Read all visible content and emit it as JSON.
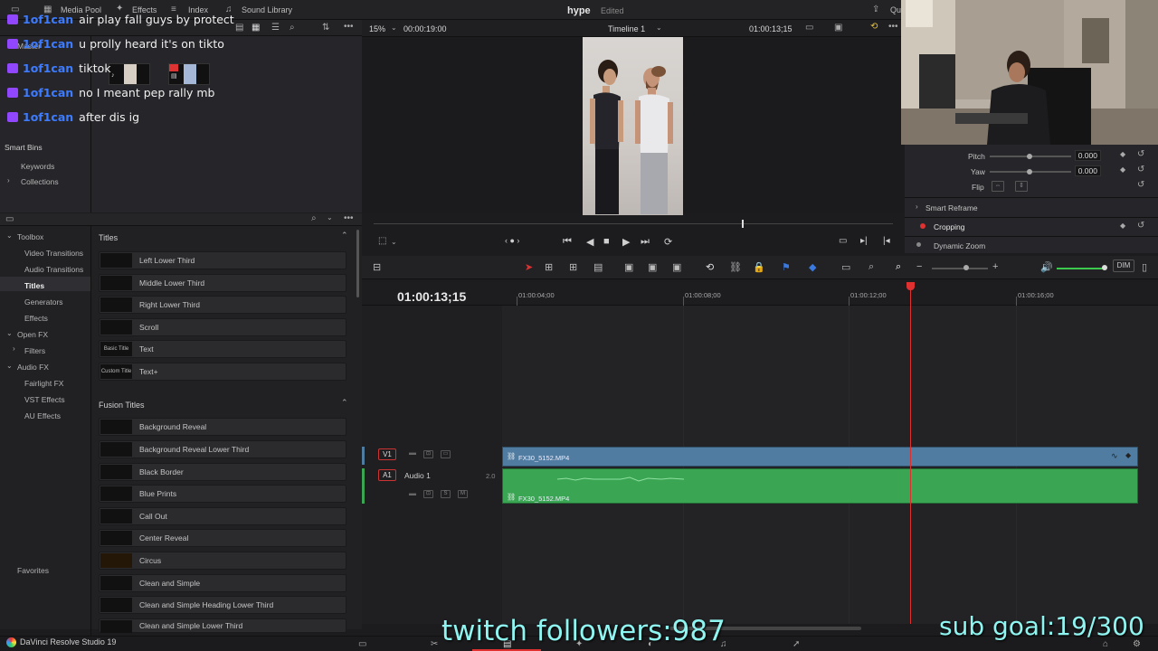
{
  "topbar": {
    "media_pool": "Media Pool",
    "effects": "Effects",
    "index": "Index",
    "sound_library": "Sound Library",
    "project_name": "hype",
    "project_status": "Edited",
    "quick_export": "Qu"
  },
  "viewer_bar": {
    "zoom": "15%",
    "source_tc": "00:00:19:00",
    "timeline_name": "Timeline 1",
    "record_tc": "01:00:13;15"
  },
  "media_pool": {
    "master": "Master",
    "smart_bins": "Smart Bins",
    "keywords": "Keywords",
    "collections": "Collections"
  },
  "inspector": {
    "pitch_label": "Pitch",
    "pitch_value": "0.000",
    "yaw_label": "Yaw",
    "yaw_value": "0.000",
    "flip_label": "Flip",
    "smart_reframe": "Smart Reframe",
    "cropping": "Cropping",
    "dynamic_zoom": "Dynamic Zoom"
  },
  "toolbox": {
    "categories": [
      "Toolbox",
      "Video Transitions",
      "Audio Transitions",
      "Titles",
      "Generators",
      "Effects",
      "Open FX",
      "Filters",
      "Audio FX",
      "Fairlight FX",
      "VST Effects",
      "AU Effects"
    ],
    "favorites": "Favorites",
    "titles_header": "Titles",
    "titles": [
      "Left Lower Third",
      "Middle Lower Third",
      "Right Lower Third",
      "Scroll",
      "Text",
      "Text+"
    ],
    "title_thumbs": [
      "",
      "",
      "",
      "",
      "Basic Title",
      "Custom Title"
    ],
    "fusion_header": "Fusion Titles",
    "fusion_titles": [
      "Background Reveal",
      "Background Reveal Lower Third",
      "Black Border",
      "Blue Prints",
      "Call Out",
      "Center Reveal",
      "Circus",
      "Clean and Simple",
      "Clean and Simple Heading Lower Third",
      "Clean and Simple Lower Third"
    ]
  },
  "timeline": {
    "timecode": "01:00:13;15",
    "ruler": [
      "01:00:04;00",
      "01:00:08;00",
      "01:00:12;00",
      "01:00:16;00"
    ],
    "v1_label": "V1",
    "a1_label": "A1",
    "audio_track_name": "Audio 1",
    "audio_channels": "2.0",
    "solo": "S",
    "mute": "M",
    "video_clip": "FX30_5152.MP4",
    "audio_clip": "FX30_5152.MP4",
    "dim": "DIM"
  },
  "chat": [
    {
      "user": "1of1can",
      "msg": "air play fall guys by protect"
    },
    {
      "user": "1of1can",
      "msg": "u prolly heard it's on tikto"
    },
    {
      "user": "1of1can",
      "msg": "tiktok"
    },
    {
      "user": "1of1can",
      "msg": "no I meant pep rally mb"
    },
    {
      "user": "1of1can",
      "msg": "after dis ig"
    }
  ],
  "overlay": {
    "followers": "twitch followers:987",
    "sub_goal": "sub goal:19/300"
  },
  "bottombar": {
    "brand": "DaVinci Resolve Studio 19"
  },
  "colors": {
    "video_clip": "#4f7ca0",
    "audio_clip": "#3aa653",
    "playhead": "#e03131",
    "overlay_text": "#8ff5f0",
    "chat_user": "#3d7bff"
  }
}
